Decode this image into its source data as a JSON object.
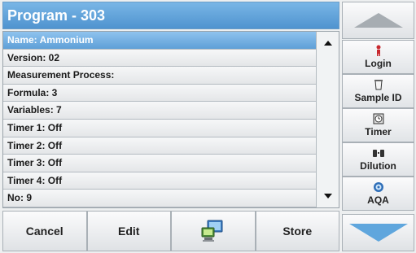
{
  "title": "Program - 303",
  "list": {
    "items": [
      "Name: Ammonium",
      "Version: 02",
      "Measurement Process:",
      "Formula: 3",
      "Variables: 7",
      "Timer 1: Off",
      "Timer 2: Off",
      "Timer 3: Off",
      "Timer 4: Off",
      "No: 9"
    ],
    "selected_index": 0
  },
  "bottom_bar": {
    "cancel_label": "Cancel",
    "edit_label": "Edit",
    "pc_icon": "computer-icon",
    "store_label": "Store"
  },
  "sidebar": {
    "login_label": "Login",
    "sample_id_label": "Sample ID",
    "timer_label": "Timer",
    "dilution_label": "Dilution",
    "aqa_label": "AQA"
  },
  "colors": {
    "accent": "#5e9fd7",
    "title_bar": "#4f93cf",
    "nav_down": "#5fa6dd",
    "nav_up": "#a7adb2"
  }
}
